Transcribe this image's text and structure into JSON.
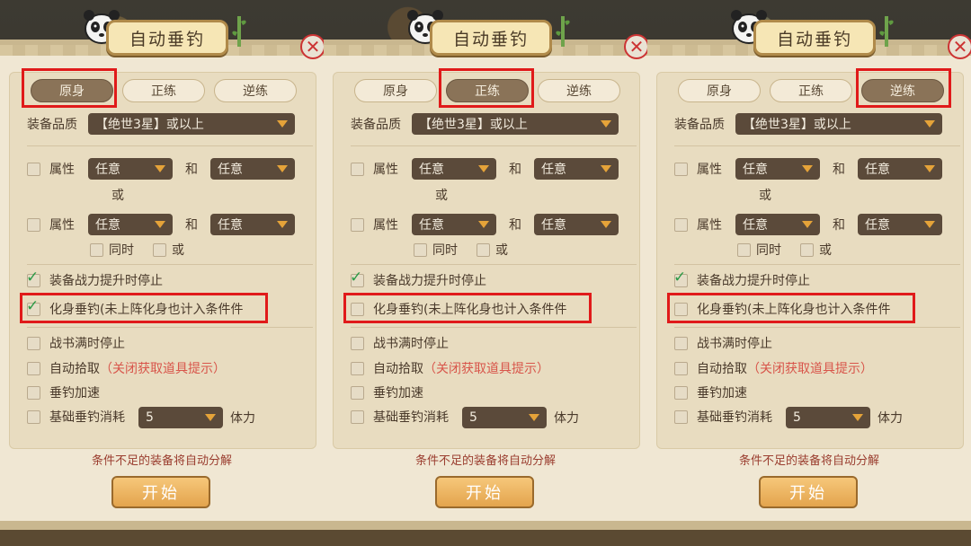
{
  "title": "自动垂钓",
  "close_icon": "close-icon",
  "tabs": [
    "原身",
    "正练",
    "逆练"
  ],
  "quality": {
    "label": "装备品质",
    "value": "【绝世3星】或以上"
  },
  "attr_rows": [
    {
      "label": "属性",
      "left_value": "任意",
      "joiner": "和",
      "right_value": "任意"
    },
    {
      "label": "属性",
      "left_value": "任意",
      "joiner": "和",
      "right_value": "任意"
    }
  ],
  "or_text": "或",
  "same_time": "同时",
  "or_option": "或",
  "checks": {
    "power_stop": "装备战力提升时停止",
    "incarnation": "化身垂钓(未上阵化身也计入条件件",
    "war_book": "战书满时停止",
    "auto_pick": "自动拾取",
    "auto_pick_hint": "（关闭获取道具提示）",
    "speed": "垂钓加速",
    "base_cost": "基础垂钓消耗",
    "base_cost_value": "5",
    "stamina": "体力"
  },
  "footer_note": "条件不足的装备将自动分解",
  "start_button": "开始",
  "panels": [
    {
      "active_tab": 0,
      "power_checked": true,
      "incarnation_checked": true
    },
    {
      "active_tab": 1,
      "power_checked": true,
      "incarnation_checked": false
    },
    {
      "active_tab": 2,
      "power_checked": true,
      "incarnation_checked": false
    }
  ],
  "colors": {
    "highlight": "#e01a1a",
    "active_tab": "#8a7358",
    "dropdown": "#5b4a3a",
    "start": "#e3a44d"
  }
}
